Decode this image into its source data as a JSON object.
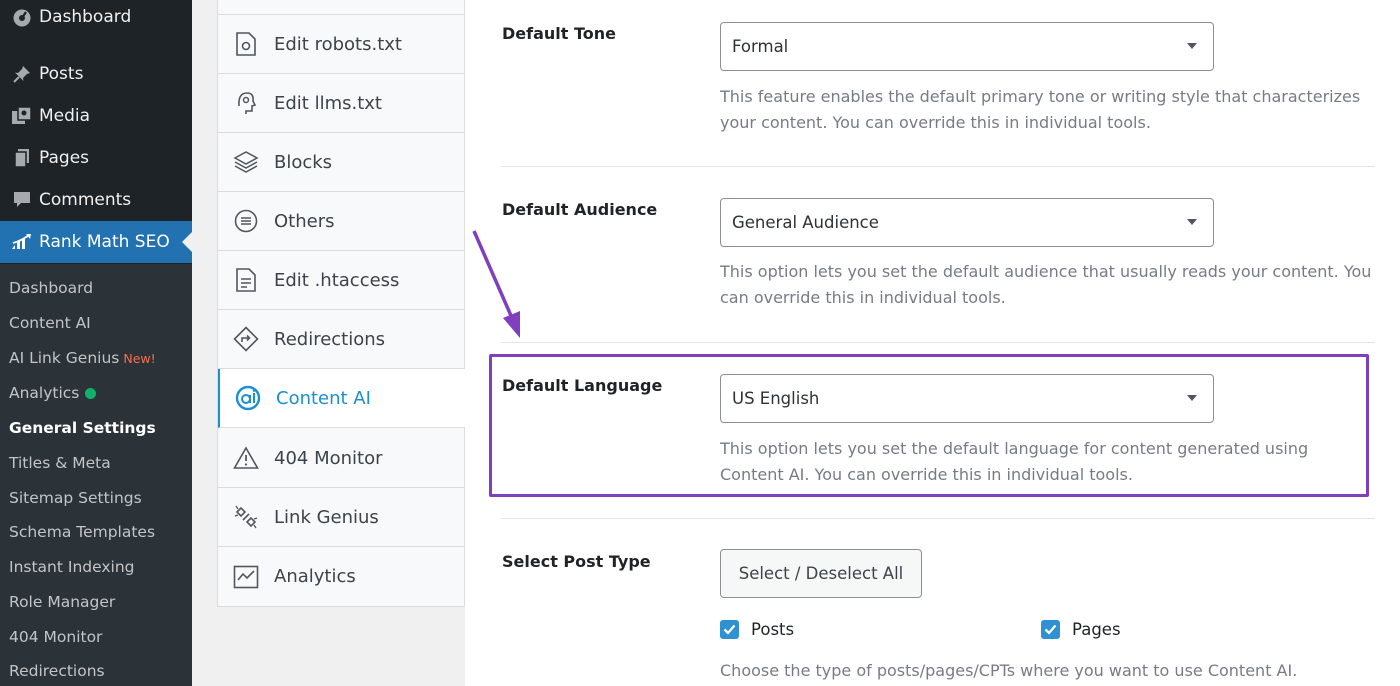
{
  "sidebar": {
    "menu": [
      {
        "label": "Dashboard",
        "icon": "dashboard-icon"
      },
      {
        "label": "Posts",
        "icon": "pin-icon"
      },
      {
        "label": "Media",
        "icon": "media-icon"
      },
      {
        "label": "Pages",
        "icon": "pages-icon"
      },
      {
        "label": "Comments",
        "icon": "comment-icon"
      },
      {
        "label": "Rank Math SEO",
        "icon": "rank-math-icon",
        "active": true
      }
    ],
    "submenu": [
      {
        "label": "Dashboard"
      },
      {
        "label": "Content AI"
      },
      {
        "label": "AI Link Genius",
        "badge": "New!"
      },
      {
        "label": "Analytics",
        "status_dot": "#11b06b"
      },
      {
        "label": "General Settings",
        "current": true
      },
      {
        "label": "Titles & Meta"
      },
      {
        "label": "Sitemap Settings"
      },
      {
        "label": "Schema Templates"
      },
      {
        "label": "Instant Indexing"
      },
      {
        "label": "Role Manager"
      },
      {
        "label": "404 Monitor"
      },
      {
        "label": "Redirections"
      }
    ]
  },
  "tools": [
    {
      "label": "Edit robots.txt",
      "icon": "robots-file-icon"
    },
    {
      "label": "Edit llms.txt",
      "icon": "llms-icon"
    },
    {
      "label": "Blocks",
      "icon": "blocks-icon"
    },
    {
      "label": "Others",
      "icon": "others-icon"
    },
    {
      "label": "Edit .htaccess",
      "icon": "htaccess-file-icon"
    },
    {
      "label": "Redirections",
      "icon": "redirections-icon"
    },
    {
      "label": "Content AI",
      "icon": "content-ai-icon",
      "active": true
    },
    {
      "label": "404 Monitor",
      "icon": "warning-icon"
    },
    {
      "label": "Link Genius",
      "icon": "link-genius-icon"
    },
    {
      "label": "Analytics",
      "icon": "analytics-icon"
    }
  ],
  "settings": {
    "tone": {
      "label": "Default Tone",
      "value": "Formal",
      "description": "This feature enables the default primary tone or writing style that characterizes your content. You can override this in individual tools."
    },
    "audience": {
      "label": "Default Audience",
      "value": "General Audience",
      "description": "This option lets you set the default audience that usually reads your content. You can override this in individual tools."
    },
    "language": {
      "label": "Default Language",
      "value": "US English",
      "description": "This option lets you set the default language for content generated using Content AI. You can override this in individual tools."
    },
    "post_type": {
      "label": "Select Post Type",
      "button": "Select / Deselect All",
      "options": [
        {
          "label": "Posts",
          "checked": true
        },
        {
          "label": "Pages",
          "checked": true
        }
      ],
      "description": "Choose the type of posts/pages/CPTs where you want to use Content AI."
    }
  },
  "colors": {
    "accent": "#2271b1",
    "rank_math_blue": "#1a90d3",
    "highlight": "#7f3fbf",
    "checkbox": "#2f91d1"
  }
}
